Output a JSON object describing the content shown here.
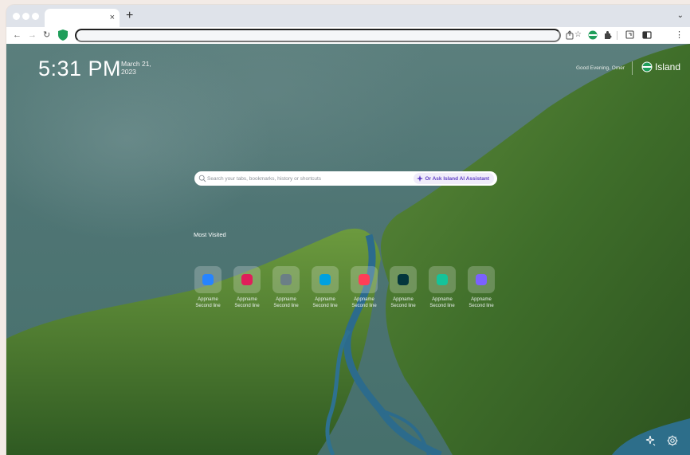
{
  "browser": {
    "tab": {
      "title": "",
      "close_glyph": "×"
    },
    "new_tab_glyph": "+",
    "tabs_menu_glyph": "⌄",
    "nav": {
      "back": "←",
      "forward": "→",
      "reload": "↻"
    },
    "address": {
      "value": ""
    },
    "toolbar_icons": [
      "share-icon",
      "bookmark-star-icon",
      "island-extension-icon",
      "puzzle-extension-icon",
      "tab-search-icon",
      "sidebar-icon",
      "kebab-menu-icon"
    ],
    "star_glyph": "☆",
    "kebab_glyph": "⋮"
  },
  "newtab": {
    "time": "5:31 PM",
    "date_line1": "March 21,",
    "date_line2": "2023",
    "greeting": "Good Evening, Omer",
    "brand": "Island",
    "search": {
      "placeholder": "Search your tabs, bookmarks, history or shortcuts",
      "ai_label": "Or Ask Island AI Assistant"
    },
    "most_visited_title": "Most Visited",
    "tiles": [
      {
        "name": "Appname",
        "sub": "Second line",
        "icon": "jira-icon",
        "color": "#2684ff"
      },
      {
        "name": "Appname",
        "sub": "Second line",
        "icon": "slack-icon",
        "color": "#e01e5a"
      },
      {
        "name": "Appname",
        "sub": "Second line",
        "icon": "generic-app-icon",
        "color": "#6b7f86"
      },
      {
        "name": "Appname",
        "sub": "Second line",
        "icon": "salesforce-icon",
        "color": "#00a1e0"
      },
      {
        "name": "Appname",
        "sub": "Second line",
        "icon": "monday-icon",
        "color": "#ff3d57"
      },
      {
        "name": "Appname",
        "sub": "Second line",
        "icon": "zendesk-icon",
        "color": "#03363d"
      },
      {
        "name": "Appname",
        "sub": "Second line",
        "icon": "grammarly-icon",
        "color": "#15c39a"
      },
      {
        "name": "Appname",
        "sub": "Second line",
        "icon": "chat-bubble-icon",
        "color": "#7b61ff"
      }
    ]
  },
  "colors": {
    "accent_purple": "#5f3fc5",
    "island_green": "#1f9e5a"
  }
}
